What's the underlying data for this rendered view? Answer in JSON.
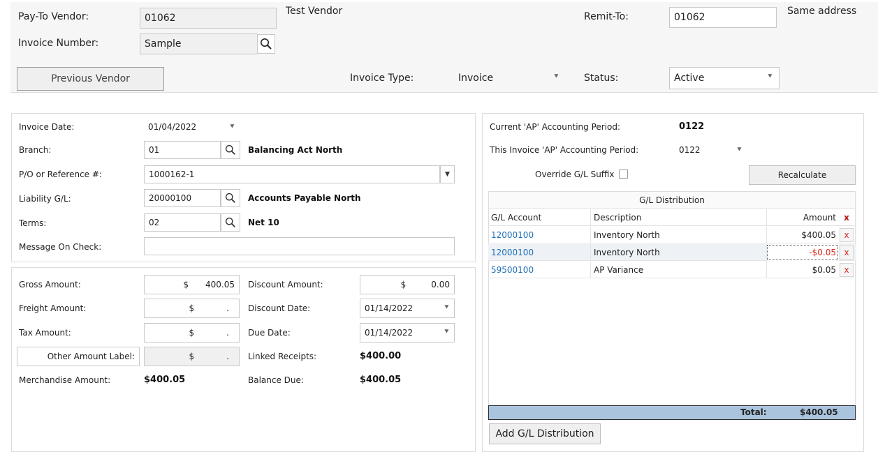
{
  "header": {
    "pay_to_vendor_label": "Pay-To Vendor:",
    "pay_to_vendor_value": "01062",
    "vendor_name": "Test Vendor",
    "remit_to_label": "Remit-To:",
    "remit_to_value": "01062",
    "remit_address": "Same address",
    "invoice_number_label": "Invoice Number:",
    "invoice_number_value": "Sample",
    "previous_vendor_label": "Previous Vendor",
    "invoice_type_label": "Invoice Type:",
    "invoice_type_value": "Invoice",
    "status_label": "Status:",
    "status_value": "Active"
  },
  "details": {
    "invoice_date_label": "Invoice Date:",
    "invoice_date_value": "01/04/2022",
    "branch_label": "Branch:",
    "branch_value": "01",
    "branch_name": "Balancing Act North",
    "po_label": "P/O or Reference #:",
    "po_value": "1000162-1",
    "liability_label": "Liability G/L:",
    "liability_value": "20000100",
    "liability_name": "Accounts Payable North",
    "terms_label": "Terms:",
    "terms_value": "02",
    "terms_name": "Net 10",
    "message_label": "Message On Check:",
    "message_value": ""
  },
  "amounts": {
    "currency": "$",
    "dot": ".",
    "gross_label": "Gross Amount:",
    "gross_value": "400.05",
    "freight_label": "Freight Amount:",
    "tax_label": "Tax Amount:",
    "other_label": "Other Amount Label:",
    "merch_label": "Merchandise Amount:",
    "merch_value": "$400.05",
    "discount_amount_label": "Discount Amount:",
    "discount_amount_value": "0.00",
    "discount_date_label": "Discount Date:",
    "discount_date_value": "01/14/2022",
    "due_date_label": "Due Date:",
    "due_date_value": "01/14/2022",
    "linked_label": "Linked Receipts:",
    "linked_value": "$400.00",
    "balance_label": "Balance Due:",
    "balance_value": "$400.05"
  },
  "accounting": {
    "current_period_label": "Current 'AP' Accounting Period:",
    "current_period_value": "0122",
    "invoice_period_label": "This Invoice 'AP' Accounting Period:",
    "invoice_period_value": "0122",
    "override_label": "Override G/L Suffix",
    "recalculate_label": "Recalculate"
  },
  "gl": {
    "title": "G/L Distribution",
    "col_account": "G/L Account",
    "col_description": "Description",
    "col_amount": "Amount",
    "col_delete": "x",
    "rows": [
      {
        "account": "12000100",
        "description": "Inventory North",
        "amount": "$400.05",
        "delete": "x"
      },
      {
        "account": "12000100",
        "description": "Inventory North",
        "amount": "-$0.05",
        "delete": "x"
      },
      {
        "account": "59500100",
        "description": "AP Variance",
        "amount": "$0.05",
        "delete": "x"
      }
    ],
    "total_label": "Total:",
    "total_value": "$400.05",
    "add_label": "Add G/L Distribution"
  },
  "colors": {
    "link_blue": "#1f6fb5",
    "negative_red": "#d9261c",
    "total_bar": "#a9c4dc"
  },
  "icons": [
    "search-icon",
    "chevron-down-icon",
    "caret-down-icon",
    "close-icon",
    "checkbox-icon"
  ]
}
